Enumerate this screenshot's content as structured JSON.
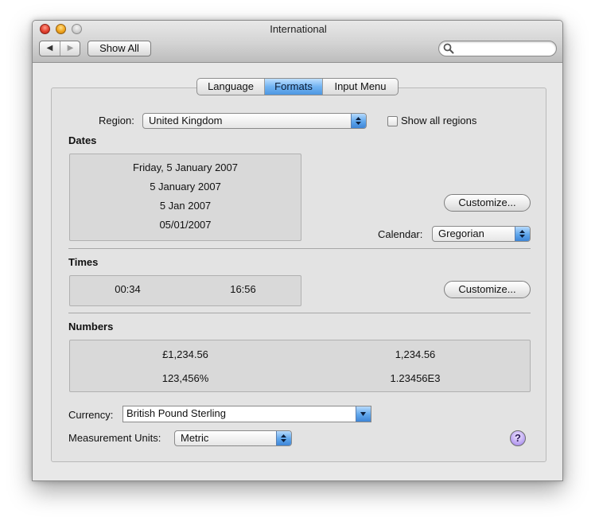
{
  "window": {
    "title": "International"
  },
  "toolbar": {
    "back_glyph": "◀",
    "forward_glyph": "▶",
    "show_all_label": "Show All",
    "search_placeholder": ""
  },
  "tabs": [
    {
      "label": "Language",
      "selected": false
    },
    {
      "label": "Formats",
      "selected": true
    },
    {
      "label": "Input Menu",
      "selected": false
    }
  ],
  "region": {
    "label": "Region:",
    "value": "United Kingdom",
    "show_all_label": "Show all regions",
    "show_all_checked": false
  },
  "dates": {
    "heading": "Dates",
    "samples": [
      "Friday, 5 January 2007",
      "5 January 2007",
      "5 Jan 2007",
      "05/01/2007"
    ],
    "customize_label": "Customize...",
    "calendar_label": "Calendar:",
    "calendar_value": "Gregorian"
  },
  "times": {
    "heading": "Times",
    "samples": [
      "00:34",
      "16:56"
    ],
    "customize_label": "Customize..."
  },
  "numbers": {
    "heading": "Numbers",
    "samples": [
      "£1,234.56",
      "1,234.56",
      "123,456%",
      "1.23456E3"
    ]
  },
  "currency": {
    "label": "Currency:",
    "value": "British Pound Sterling"
  },
  "measurement": {
    "label": "Measurement Units:",
    "value": "Metric"
  },
  "help": {
    "glyph": "?"
  },
  "colors": {
    "accent": "#5fa6ec",
    "selected_tab": "#72b4f2",
    "help_button": "#b59cf0"
  }
}
